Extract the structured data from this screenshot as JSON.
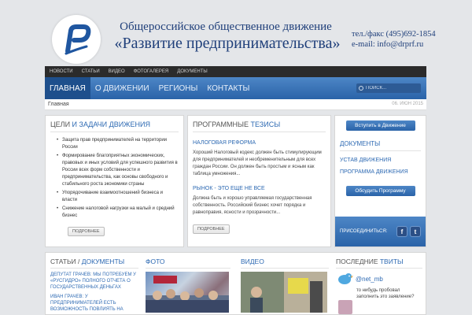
{
  "header": {
    "org_line1": "Общероссийское общественное движение",
    "org_line2": "«Развитие предпринимательства»",
    "phone": "тел./факс (495)692-1854",
    "email": "e-mail: info@drprf.ru"
  },
  "top_nav": [
    "НОВОСТИ",
    "СТАТЬИ",
    "ВИДЕО",
    "ФОТОГАЛЕРЕЯ",
    "ДОКУМЕНТЫ"
  ],
  "main_nav": {
    "items": [
      "ГЛАВНАЯ",
      "О ДВИЖЕНИИ",
      "РЕГИОНЫ",
      "КОНТАКТЫ"
    ],
    "search_placeholder": "ПОИСК..."
  },
  "breadcrumb": {
    "current": "Главная",
    "date": "06. ИЮН 2015"
  },
  "goals": {
    "title_plain": "ЦЕЛИ",
    "title_accent": " И ЗАДАЧИ ДВИЖЕНИЯ",
    "items": [
      "Защита прав предпринимателей на территории России",
      "Формирование благоприятных экономических, правовых и иных условий для успешного развития в России всех форм собственности и предпринимательства, как основы свободного и стабильного роста экономики страны",
      "Упорядочивание взаимоотношений бизнеса и власти",
      "Снижение налоговой нагрузки на малый и средний бизнес"
    ],
    "more": "ПОДРОБНЕЕ"
  },
  "thesis": {
    "title_plain": "ПРОГРАММНЫЕ",
    "title_accent": " ТЕЗИСЫ",
    "sections": [
      {
        "heading": "НАЛОГОВАЯ РЕФОРМА",
        "text": "Хороший Налоговый кодекс должен быть стимулирующим для предпринимателей и необременительным для всех граждан России. Он должен быть простым и ясным как таблица умножения..."
      },
      {
        "heading": "РЫНОК - ЭТО ЕЩЕ НЕ ВСЕ",
        "text": "Должна быть и хорошо управляемая государственная собственность. Российский бизнес хочет порядка и равноправия, ясности и прозрачности..."
      }
    ],
    "more": "ПОДРОБНЕЕ"
  },
  "sidebar": {
    "join_button": "Вступить в Движение",
    "documents_heading": "ДОКУМЕНТЫ",
    "links": [
      "УСТАВ ДВИЖЕНИЯ",
      "ПРОГРАММА ДВИЖЕНИЯ"
    ],
    "discuss_button": "Обсудить Программу",
    "join_social": "ПРИСОЕДИНИТЬСЯ:",
    "facebook_letter": "f",
    "twitter_letter": "t"
  },
  "bottom": {
    "articles_plain": "СТАТЬИ /",
    "articles_accent": " ДОКУМЕНТЫ",
    "articles": [
      "ДЕПУТАТ ГРАЧЕВ: МЫ ПОТРЕБУЕМ У «РУСГИДРО» ПОЛНОГО ОТЧЕТА О ГОСУДАРСТВЕННЫХ ДЕНЬГАХ",
      "ИВАН ГРАЧЕВ: У ПРЕДПРИНИМАТЕЛЕЙ ЕСТЬ ВОЗМОЖНОСТЬ ПОВЛИЯТЬ НА"
    ],
    "photo_title": "ФОТО",
    "video_title": "ВИДЕО",
    "tweets_plain": "ПОСЛЕДНИЕ",
    "tweets_accent": " ТВИТЫ",
    "handle": "@net_mb",
    "tweet": "то нибудь пробовал заполнить это заявление?"
  },
  "colors": {
    "accent": "#2e6ab3",
    "nav": "#2a63a8",
    "topbar": "#2b2b2b",
    "title": "#1f3f7a"
  }
}
